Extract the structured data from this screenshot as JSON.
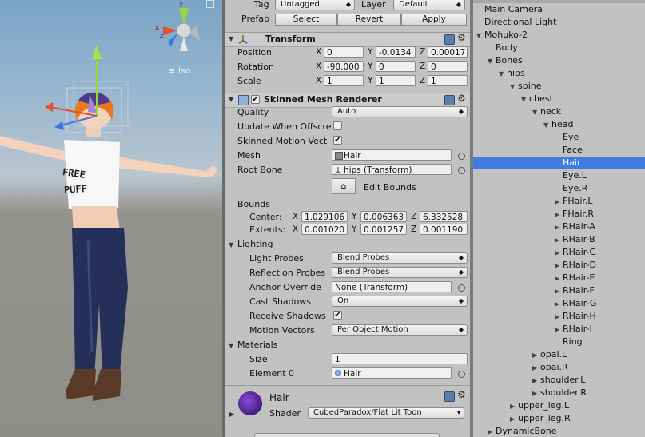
{
  "scene": {
    "iso_label": "Iso",
    "gizmo_axes": {
      "x": "x",
      "y": "y",
      "z": "z"
    },
    "shirt_text": [
      "FREE",
      "PUFF"
    ]
  },
  "inspector": {
    "tag_label": "Tag",
    "tag_value": "Untagged",
    "layer_label": "Layer",
    "layer_value": "Default",
    "prefab_label": "Prefab",
    "prefab_buttons": [
      "Select",
      "Revert",
      "Apply"
    ],
    "transform": {
      "title": "Transform",
      "position_label": "Position",
      "position": {
        "x": "0",
        "y": "-0.0134",
        "z": "0.00017"
      },
      "rotation_label": "Rotation",
      "rotation": {
        "x": "-90.000",
        "y": "0",
        "z": "0"
      },
      "scale_label": "Scale",
      "scale": {
        "x": "1",
        "y": "1",
        "z": "1"
      }
    },
    "smr": {
      "title": "Skinned Mesh Renderer",
      "enabled": true,
      "quality_label": "Quality",
      "quality_value": "Auto",
      "update_offscreen_label": "Update When Offscre",
      "update_offscreen": false,
      "motion_vectors_label": "Skinned Motion Vect",
      "motion_vectors": true,
      "mesh_label": "Mesh",
      "mesh_value": "Hair",
      "root_bone_label": "Root Bone",
      "root_bone_value": "hips (Transform)",
      "edit_bounds_label": "Edit Bounds",
      "bounds_label": "Bounds",
      "center_label": "Center:",
      "center": {
        "x": "1.029106",
        "y": "0.006363",
        "z": "6.332528"
      },
      "extents_label": "Extents:",
      "extents": {
        "x": "0.001020",
        "y": "0.001257",
        "z": "0.001190"
      },
      "lighting_label": "Lighting",
      "light_probes_label": "Light Probes",
      "light_probes_value": "Blend Probes",
      "reflection_probes_label": "Reflection Probes",
      "reflection_probes_value": "Blend Probes",
      "anchor_override_label": "Anchor Override",
      "anchor_override_value": "None (Transform)",
      "cast_shadows_label": "Cast Shadows",
      "cast_shadows_value": "On",
      "receive_shadows_label": "Receive Shadows",
      "receive_shadows": true,
      "motion_vectors2_label": "Motion Vectors",
      "motion_vectors2_value": "Per Object Motion",
      "materials_label": "Materials",
      "size_label": "Size",
      "size_value": "1",
      "element0_label": "Element 0",
      "element0_value": "Hair"
    },
    "material": {
      "name": "Hair",
      "shader_label": "Shader",
      "shader_value": "CubedParadox/Flat Lit Toon"
    }
  },
  "hierarchy": {
    "rows": [
      {
        "label": "Main Camera",
        "depth": 1,
        "arrow": ""
      },
      {
        "label": "Directional Light",
        "depth": 1,
        "arrow": ""
      },
      {
        "label": "Mohuko-2",
        "depth": 1,
        "arrow": "down"
      },
      {
        "label": "Body",
        "depth": 2,
        "arrow": ""
      },
      {
        "label": "Bones",
        "depth": 2,
        "arrow": "down"
      },
      {
        "label": "hips",
        "depth": 3,
        "arrow": "down"
      },
      {
        "label": "spine",
        "depth": 4,
        "arrow": "down"
      },
      {
        "label": "chest",
        "depth": 5,
        "arrow": "down"
      },
      {
        "label": "neck",
        "depth": 6,
        "arrow": "down"
      },
      {
        "label": "head",
        "depth": 7,
        "arrow": "down"
      },
      {
        "label": "Eye",
        "depth": 8,
        "arrow": ""
      },
      {
        "label": "Face",
        "depth": 8,
        "arrow": ""
      },
      {
        "label": "Hair",
        "depth": 8,
        "arrow": "",
        "selected": true
      },
      {
        "label": "Eye.L",
        "depth": 8,
        "arrow": ""
      },
      {
        "label": "Eye.R",
        "depth": 8,
        "arrow": ""
      },
      {
        "label": "FHair.L",
        "depth": 8,
        "arrow": "right"
      },
      {
        "label": "FHair.R",
        "depth": 8,
        "arrow": "right"
      },
      {
        "label": "RHair-A",
        "depth": 8,
        "arrow": "right"
      },
      {
        "label": "RHair-B",
        "depth": 8,
        "arrow": "right"
      },
      {
        "label": "RHair-C",
        "depth": 8,
        "arrow": "right"
      },
      {
        "label": "RHair-D",
        "depth": 8,
        "arrow": "right"
      },
      {
        "label": "RHair-E",
        "depth": 8,
        "arrow": "right"
      },
      {
        "label": "RHair-F",
        "depth": 8,
        "arrow": "right"
      },
      {
        "label": "RHair-G",
        "depth": 8,
        "arrow": "right"
      },
      {
        "label": "RHair-H",
        "depth": 8,
        "arrow": "right"
      },
      {
        "label": "RHair-I",
        "depth": 8,
        "arrow": "right"
      },
      {
        "label": "Ring",
        "depth": 8,
        "arrow": ""
      },
      {
        "label": "opai.L",
        "depth": 6,
        "arrow": "right"
      },
      {
        "label": "opai.R",
        "depth": 6,
        "arrow": "right"
      },
      {
        "label": "shoulder.L",
        "depth": 6,
        "arrow": "right"
      },
      {
        "label": "shoulder.R",
        "depth": 6,
        "arrow": "right"
      },
      {
        "label": "upper_leg.L",
        "depth": 4,
        "arrow": "right"
      },
      {
        "label": "upper_leg.R",
        "depth": 4,
        "arrow": "right"
      },
      {
        "label": "DynamicBone",
        "depth": 2,
        "arrow": "right"
      }
    ]
  },
  "colors": {
    "selection": "#3e7ce0",
    "panel": "#c2c2c2"
  }
}
